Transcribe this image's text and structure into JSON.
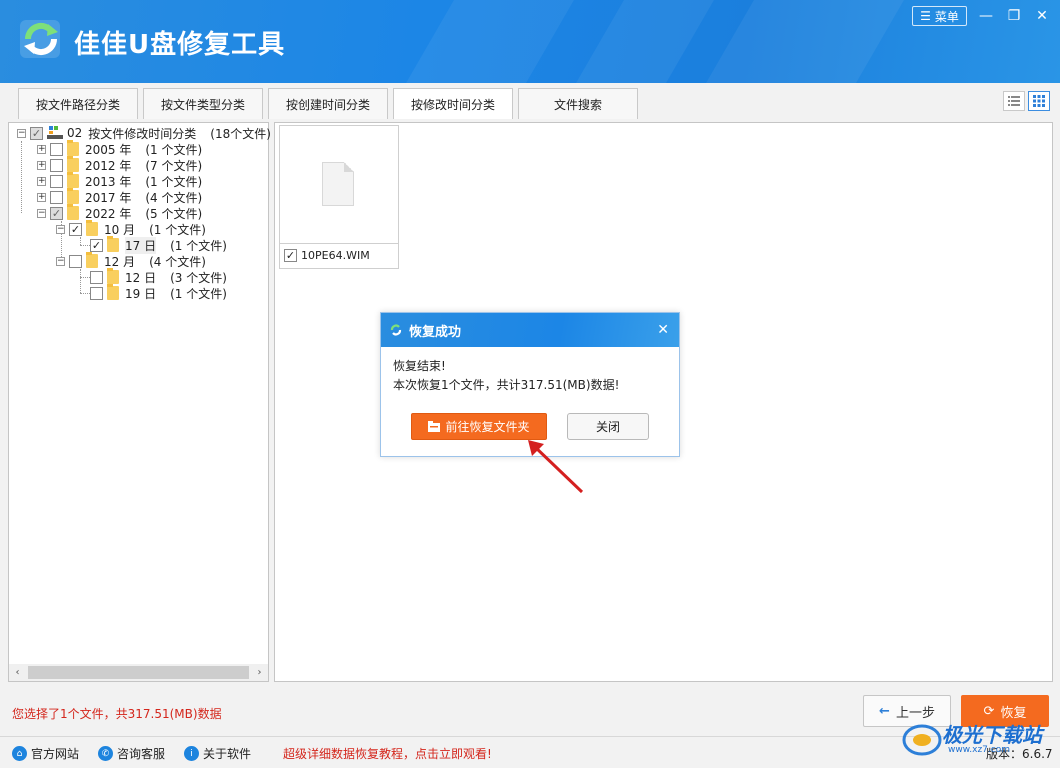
{
  "window": {
    "title": "佳佳U盘修复工具",
    "menu_label": "菜单",
    "minimize_glyph": "—",
    "maximize_glyph": "❐",
    "close_glyph": "✕"
  },
  "tabs": [
    {
      "label": "按文件路径分类",
      "active": false
    },
    {
      "label": "按文件类型分类",
      "active": false
    },
    {
      "label": "按创建时间分类",
      "active": false
    },
    {
      "label": "按修改时间分类",
      "active": true
    },
    {
      "label": "文件搜索",
      "active": false
    }
  ],
  "tree": {
    "root": {
      "id": "02",
      "label": "按文件修改时间分类",
      "count": "(18个文件)"
    },
    "years": [
      {
        "label": "2005 年",
        "count": "(1 个文件)"
      },
      {
        "label": "2012 年",
        "count": "(7 个文件)"
      },
      {
        "label": "2013 年",
        "count": "(1 个文件)"
      },
      {
        "label": "2017 年",
        "count": "(4 个文件)"
      },
      {
        "label": "2022 年",
        "count": "(5 个文件)"
      }
    ],
    "months": [
      {
        "label": "10 月",
        "count": "(1 个文件)"
      },
      {
        "label": "12 月",
        "count": "(4 个文件)"
      }
    ],
    "days": [
      {
        "label": "17 日",
        "count": "(1 个文件)"
      },
      {
        "label": "12 日",
        "count": "(3 个文件)"
      },
      {
        "label": "19 日",
        "count": "(1 个文件)"
      }
    ]
  },
  "files": [
    {
      "name": "10PE64.WIM",
      "checked": true
    }
  ],
  "dialog": {
    "title": "恢复成功",
    "line1": "恢复结束!",
    "line2": "本次恢复1个文件，共计317.51(MB)数据!",
    "open_folder_label": "前往恢复文件夹",
    "close_label": "关闭",
    "close_glyph": "✕"
  },
  "status": {
    "selection_text": "您选择了1个文件，共317.51(MB)数据"
  },
  "buttons": {
    "prev_label": "上一步",
    "recover_label": "恢复"
  },
  "footer": {
    "official_site": "官方网站",
    "support": "咨询客服",
    "about": "关于软件",
    "promo": "超级详细数据恢复教程，点击立即观看!",
    "version": "版本：6.6.7"
  },
  "watermark": {
    "text": "极光下载站",
    "sub": "www.xz7.com"
  },
  "colors": {
    "header_blue": "#1c86e6",
    "accent_orange": "#f46a1f",
    "status_red": "#d4261c"
  }
}
